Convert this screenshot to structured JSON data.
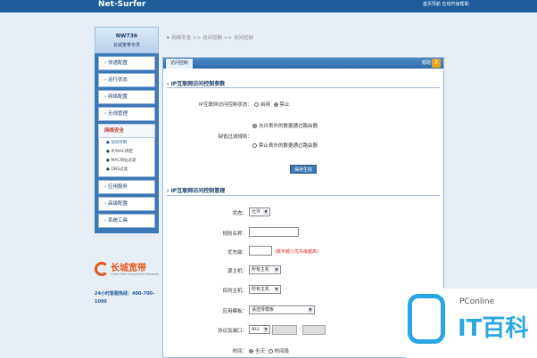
{
  "header": {
    "brand": "Net-Surfer",
    "links": "首页导航  在线升级帮助"
  },
  "sidebar": {
    "model": "NW736",
    "subtitle": "长城宽带专供",
    "items": [
      {
        "label": "快速配置"
      },
      {
        "label": "运行状态"
      },
      {
        "label": "网络配置"
      },
      {
        "label": "无线管理"
      },
      {
        "label": "网络安全",
        "active": true
      },
      {
        "label": "应用服务"
      },
      {
        "label": "高级配置"
      },
      {
        "label": "系统工具"
      }
    ],
    "subitems": [
      "访问控制",
      "IP/MAC绑定",
      "MAC地址过滤",
      "DNS过滤"
    ],
    "current_sub": "访问控制"
  },
  "brand_logo": {
    "name": "长城宽带",
    "english": "Great Wall Broadband Network"
  },
  "hotline": "24小时客服热线：400-700-1000",
  "breadcrumb": {
    "home": "网络安全",
    "sep1": ">>",
    "mid": "访问控制",
    "sep2": ">>",
    "last": "访问控制"
  },
  "tab": {
    "label": "访问控制",
    "help": "帮助",
    "help_icon": "?"
  },
  "section1": {
    "title": "IP互联网访问控制参数",
    "status_label": "IP互联网访问控制状态：",
    "status_opt1": "启用",
    "status_opt2": "禁止",
    "status_selected": "禁止",
    "rule_label": "缺省过滤规则：",
    "rule_opt1": "允许表外的数据通过路由器",
    "rule_opt2": "禁止表外的数据通过路由器",
    "save_button": "保存生效"
  },
  "section2": {
    "title": "IP互联网访问控制管理",
    "state_label": "状态：",
    "state_value": "允许",
    "name_label": "规则名称：",
    "name_value": "",
    "priority_label": "优先级：",
    "priority_value": "",
    "priority_hint": "(数字越小优先级越高)",
    "src_label": "源主机：",
    "src_value": "所有主机",
    "dst_label": "目的主机：",
    "dst_value": "所有主机",
    "template_label": "应用模板：",
    "template_value": "请选择模板",
    "proto_label": "协议及端口：",
    "proto_value": "ALL",
    "port_sep": "-",
    "time_label": "时间：",
    "time_opt1": "全天",
    "time_opt2": "时间段"
  },
  "watermark": {
    "brand": "PConline",
    "big": "IT百科"
  },
  "colors": {
    "primary": "#3d78b6",
    "accent": "#e05a1c",
    "hint": "#d7261e"
  }
}
